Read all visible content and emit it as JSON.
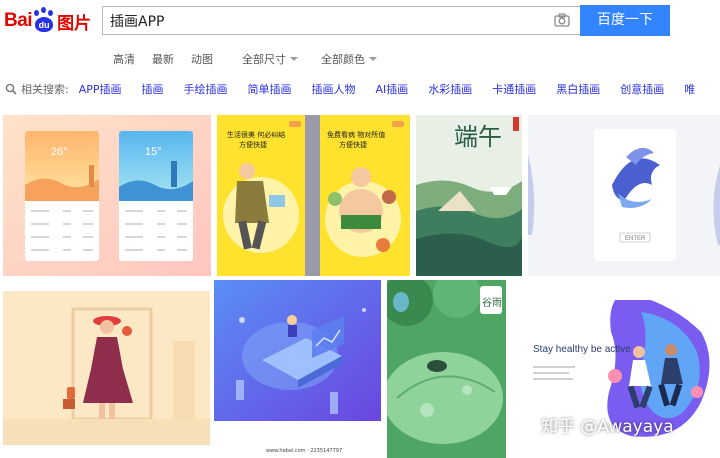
{
  "brand": {
    "bai": "Bai",
    "du": "du",
    "tupian": "图片"
  },
  "search": {
    "value": "插画APP",
    "button_label": "百度一下"
  },
  "filters": [
    {
      "label": "高清",
      "dropdown": false
    },
    {
      "label": "最新",
      "dropdown": false
    },
    {
      "label": "动图",
      "dropdown": false
    },
    {
      "label": "全部尺寸",
      "dropdown": true
    },
    {
      "label": "全部颜色",
      "dropdown": true
    }
  ],
  "related": {
    "label": "相关搜索:",
    "keywords": [
      "APP插画",
      "插画",
      "手绘插画",
      "简单插画",
      "插画人物",
      "AI插画",
      "水彩插画",
      "卡通插画",
      "黑白插画",
      "创意插画",
      "唯"
    ]
  },
  "results": {
    "weather_temps": [
      "26°",
      "15°"
    ],
    "poster_left_text": [
      "生活很美 何必纠结",
      "方便快捷"
    ],
    "poster_right_text": [
      "免费看病 物对所值",
      "方便快捷"
    ],
    "duanwu_title": "端午",
    "fish_button": "ENTER",
    "landing_heading": "Stay healthy be active",
    "footer_credit": "www.hebei.com · 2235147797",
    "rain_label": "谷雨",
    "watermark": "知乎 @Awayaya"
  },
  "colors": {
    "accent": "#3385ff",
    "brand_red": "#e10601",
    "brand_blue": "#2932e1",
    "link": "#2932e1"
  }
}
